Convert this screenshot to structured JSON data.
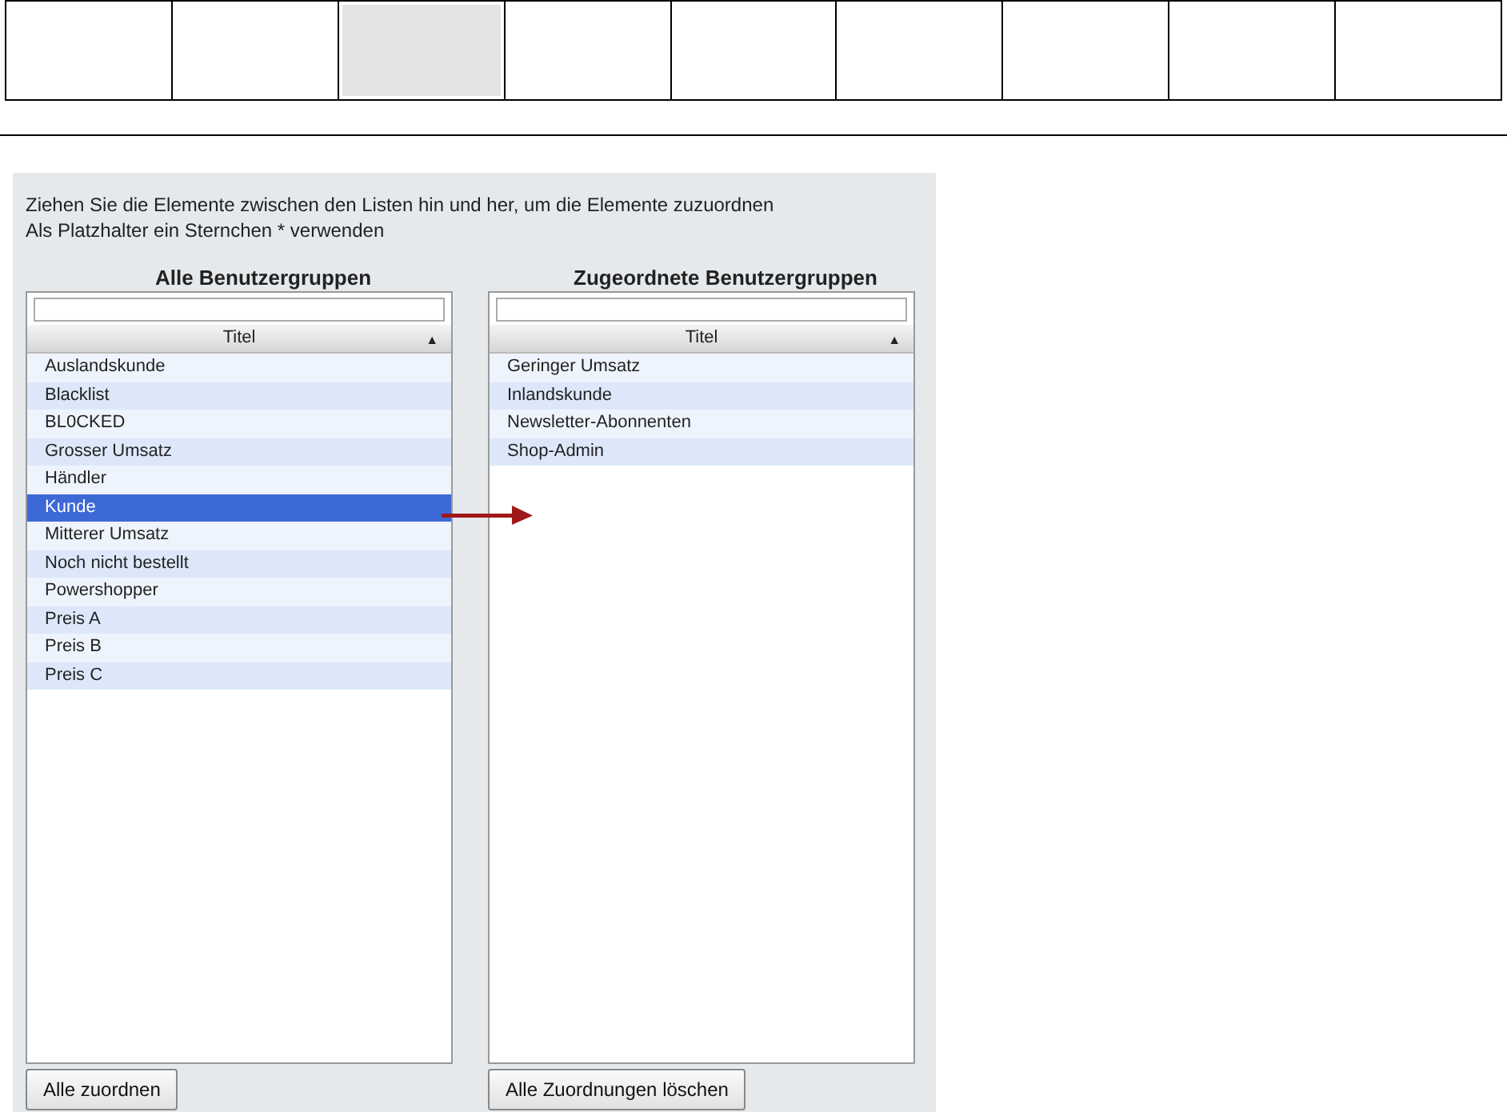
{
  "tabs": [
    {
      "selected": false
    },
    {
      "selected": false
    },
    {
      "selected": true
    },
    {
      "selected": false
    },
    {
      "selected": false
    },
    {
      "selected": false
    },
    {
      "selected": false
    },
    {
      "selected": false
    },
    {
      "selected": false
    }
  ],
  "instructions": [
    "Ziehen Sie die Elemente zwischen den Listen hin und her, um die Elemente zuzuordnen",
    "Als Platzhalter ein Sternchen * verwenden"
  ],
  "lists": [
    {
      "title": "Alle Benutzergruppen",
      "column": "Titel",
      "sort_icon": "▲",
      "items": [
        {
          "label": "Auslandskunde",
          "selected": false
        },
        {
          "label": "Blacklist",
          "selected": false
        },
        {
          "label": "BL0CKED",
          "selected": false
        },
        {
          "label": "Grosser Umsatz",
          "selected": false
        },
        {
          "label": "Händler",
          "selected": false
        },
        {
          "label": "Kunde",
          "selected": true
        },
        {
          "label": "Mitterer Umsatz",
          "selected": false
        },
        {
          "label": "Noch nicht bestellt",
          "selected": false
        },
        {
          "label": "Powershopper",
          "selected": false
        },
        {
          "label": "Preis A",
          "selected": false
        },
        {
          "label": "Preis B",
          "selected": false
        },
        {
          "label": "Preis C",
          "selected": false
        }
      ],
      "button": "Alle zuordnen"
    },
    {
      "title": "Zugeordnete Benutzergruppen",
      "column": "Titel",
      "sort_icon": "▲",
      "items": [
        {
          "label": "Geringer Umsatz",
          "selected": false
        },
        {
          "label": "Inlandskunde",
          "selected": false
        },
        {
          "label": "Newsletter-Abonnenten",
          "selected": false
        },
        {
          "label": "Shop-Admin",
          "selected": false
        }
      ],
      "button": "Alle Zuordnungen löschen"
    }
  ]
}
